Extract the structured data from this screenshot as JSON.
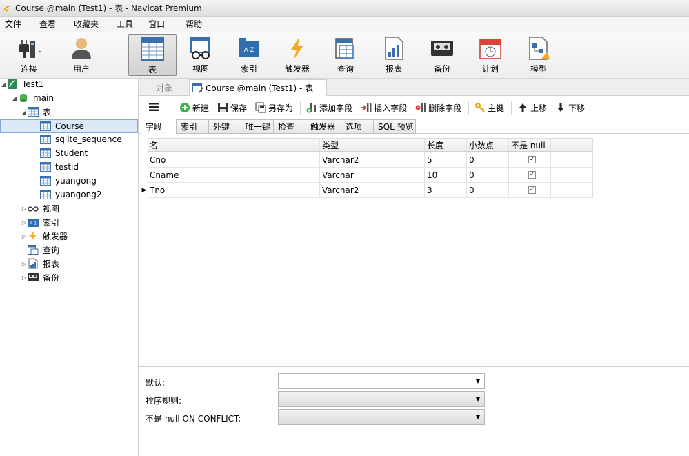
{
  "window": {
    "title": "Course @main (Test1) - 表 - Navicat Premium"
  },
  "menu": [
    "文件",
    "查看",
    "收藏夹",
    "工具",
    "窗口",
    "帮助"
  ],
  "toolbar": {
    "connect": "连接",
    "user": "用户",
    "table": "表",
    "view": "视图",
    "index": "索引",
    "trigger": "触发器",
    "query": "查询",
    "report": "报表",
    "backup": "备份",
    "schedule": "计划",
    "model": "模型"
  },
  "tree": {
    "connection": "Test1",
    "database": "main",
    "tables_group": "表",
    "tables": [
      "Course",
      "sqlite_sequence",
      "Student",
      "testid",
      "yuangong",
      "yuangong2"
    ],
    "views": "视图",
    "indexes": "索引",
    "triggers": "触发器",
    "queries": "查询",
    "reports": "报表",
    "backups": "备份"
  },
  "doc_tabs": {
    "objects": "对象",
    "active": "Course @main (Test1) - 表"
  },
  "edit_toolbar": {
    "new": "新建",
    "save": "保存",
    "save_as": "另存为",
    "add_field": "添加字段",
    "insert_field": "插入字段",
    "delete_field": "删除字段",
    "primary_key": "主键",
    "move_up": "上移",
    "move_down": "下移"
  },
  "sub_tabs": [
    "字段",
    "索引",
    "外键",
    "唯一键",
    "检查",
    "触发器",
    "选项",
    "SQL 预览"
  ],
  "fields_grid": {
    "columns": [
      "名",
      "类型",
      "长度",
      "小数点",
      "不是 null"
    ],
    "rows": [
      {
        "name": "Cno",
        "type": "Varchar2",
        "length": "5",
        "decimals": "0",
        "not_null": true
      },
      {
        "name": "Cname",
        "type": "Varchar",
        "length": "10",
        "decimals": "0",
        "not_null": true
      },
      {
        "name": "Tno",
        "type": "Varchar2",
        "length": "3",
        "decimals": "0",
        "not_null": true
      }
    ]
  },
  "properties": {
    "default_label": "默认:",
    "collation_label": "排序规则:",
    "not_null_conflict_label": "不是 null ON CONFLICT:"
  }
}
